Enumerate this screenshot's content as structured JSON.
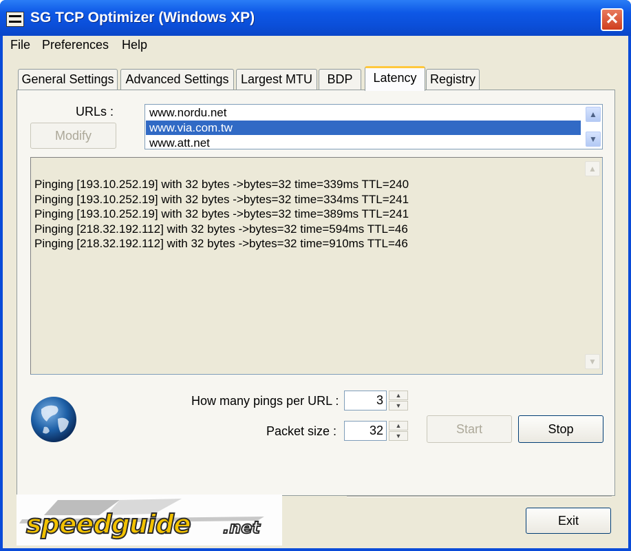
{
  "window": {
    "title": "SG TCP Optimizer (Windows XP)"
  },
  "menu": {
    "items": [
      "File",
      "Preferences",
      "Help"
    ]
  },
  "tabs": [
    {
      "label": "General Settings",
      "active": false
    },
    {
      "label": "Advanced Settings",
      "active": false
    },
    {
      "label": "Largest MTU",
      "active": false
    },
    {
      "label": "BDP",
      "active": false
    },
    {
      "label": "Latency",
      "active": true
    },
    {
      "label": "Registry",
      "active": false
    }
  ],
  "latency": {
    "urls_label": "URLs :",
    "modify_label": "Modify",
    "urls": [
      "www.nordu.net",
      "www.via.com.tw",
      "www.att.net"
    ],
    "selected_url": "www.via.com.tw",
    "output_lines": [
      "Pinging [193.10.252.19] with 32 bytes ->bytes=32 time=339ms TTL=240",
      "Pinging [193.10.252.19] with 32 bytes ->bytes=32 time=334ms TTL=241",
      "Pinging [193.10.252.19] with 32 bytes ->bytes=32 time=389ms TTL=241",
      "Pinging [218.32.192.112] with 32 bytes ->bytes=32 time=594ms TTL=46",
      "Pinging [218.32.192.112] with 32 bytes ->bytes=32 time=910ms TTL=46"
    ],
    "pings_label": "How many pings per URL :",
    "pings_value": "3",
    "packet_label": "Packet size :",
    "packet_value": "32",
    "start_label": "Start",
    "stop_label": "Stop"
  },
  "footer": {
    "logo_text": "speedguide.net",
    "exit_label": "Exit"
  },
  "colors": {
    "titlebar": "#0b4fd9",
    "selection": "#316ac5",
    "dialog_bg": "#ece9d8",
    "close_button": "#cf3e1e"
  }
}
